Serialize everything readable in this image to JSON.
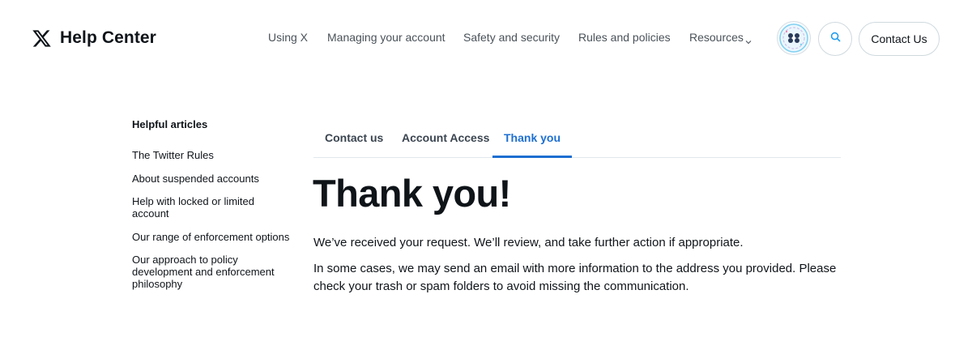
{
  "header": {
    "brand_title": "Help Center",
    "nav": {
      "using_x": "Using X",
      "managing_account": "Managing your account",
      "safety_security": "Safety and security",
      "rules_policies": "Rules and policies",
      "resources": "Resources"
    },
    "contact_button": "Contact Us",
    "icons": {
      "logo": "x-logo-icon",
      "resources_chevron": "chevron-down-icon",
      "search": "search-icon",
      "avatar": "avatar"
    },
    "colors": {
      "accent": "#1d9bf0",
      "text": "#0f1419"
    }
  },
  "sidebar": {
    "heading": "Helpful articles",
    "items": [
      {
        "label": "The Twitter Rules"
      },
      {
        "label": "About suspended accounts"
      },
      {
        "label": "Help with locked or limited account"
      },
      {
        "label": "Our range of enforcement options"
      },
      {
        "label": "Our approach to policy development and enforcement philosophy"
      }
    ]
  },
  "tabs": [
    {
      "label": "Contact us",
      "active": false
    },
    {
      "label": "Account Access",
      "active": false
    },
    {
      "label": "Thank you",
      "active": true
    }
  ],
  "main": {
    "heading": "Thank you!",
    "paragraph_1": "We’ve received your request. We’ll review, and take further action if appropriate.",
    "paragraph_2": "In some cases, we may send an email with more information to the address you provided. Please check your trash or spam folders to avoid missing the communication.",
    "active_tab_color": "#1d6fd1"
  }
}
